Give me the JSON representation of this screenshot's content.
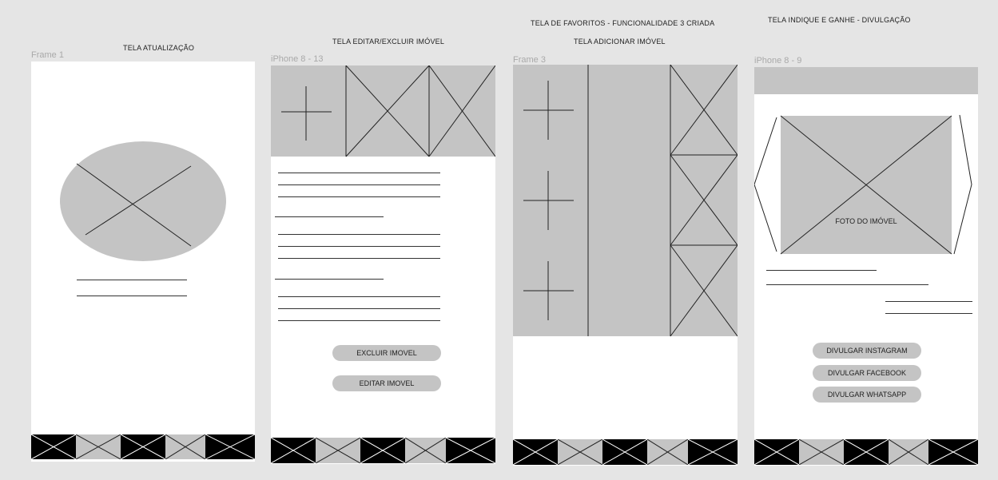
{
  "canvas": {
    "background": "#e5e5e5"
  },
  "headings": {
    "atualizacao": "TELA ATUALIZAÇÃO",
    "editar_excluir": "TELA EDITAR/EXCLUIR IMÓVEL",
    "favoritos": "TELA DE FAVORITOS - FUNCIONALIDADE 3 CRIADA",
    "adicionar": "TELA ADICIONAR IMÓVEL",
    "indique": "TELA INDIQUE E GANHE - DIVULGAÇÃO"
  },
  "frames": {
    "frame1": {
      "label": "Frame 1"
    },
    "editar": {
      "label": "iPhone 8 - 13",
      "buttons": {
        "excluir": "EXCLUIR IMOVEL",
        "editar": "EDITAR IMOVEL"
      }
    },
    "frame3": {
      "label": "Frame 3"
    },
    "indique": {
      "label": "iPhone 8 - 9",
      "photo_label": "FOTO DO IMÓVEL",
      "buttons": {
        "instagram": "DIVULGAR INSTAGRAM",
        "facebook": "DIVULGAR FACEBOOK",
        "whatsapp": "DIVULGAR WHATSAPP"
      }
    }
  },
  "colors": {
    "placeholder_fill": "#c4c4c4",
    "nav_dark": "#000000",
    "frame_bg": "#ffffff"
  },
  "icons": {
    "image_placeholder": "crossed-rectangle-icon",
    "add": "plus-icon",
    "carousel_prev": "chevron-left-icon",
    "carousel_next": "chevron-right-icon"
  }
}
